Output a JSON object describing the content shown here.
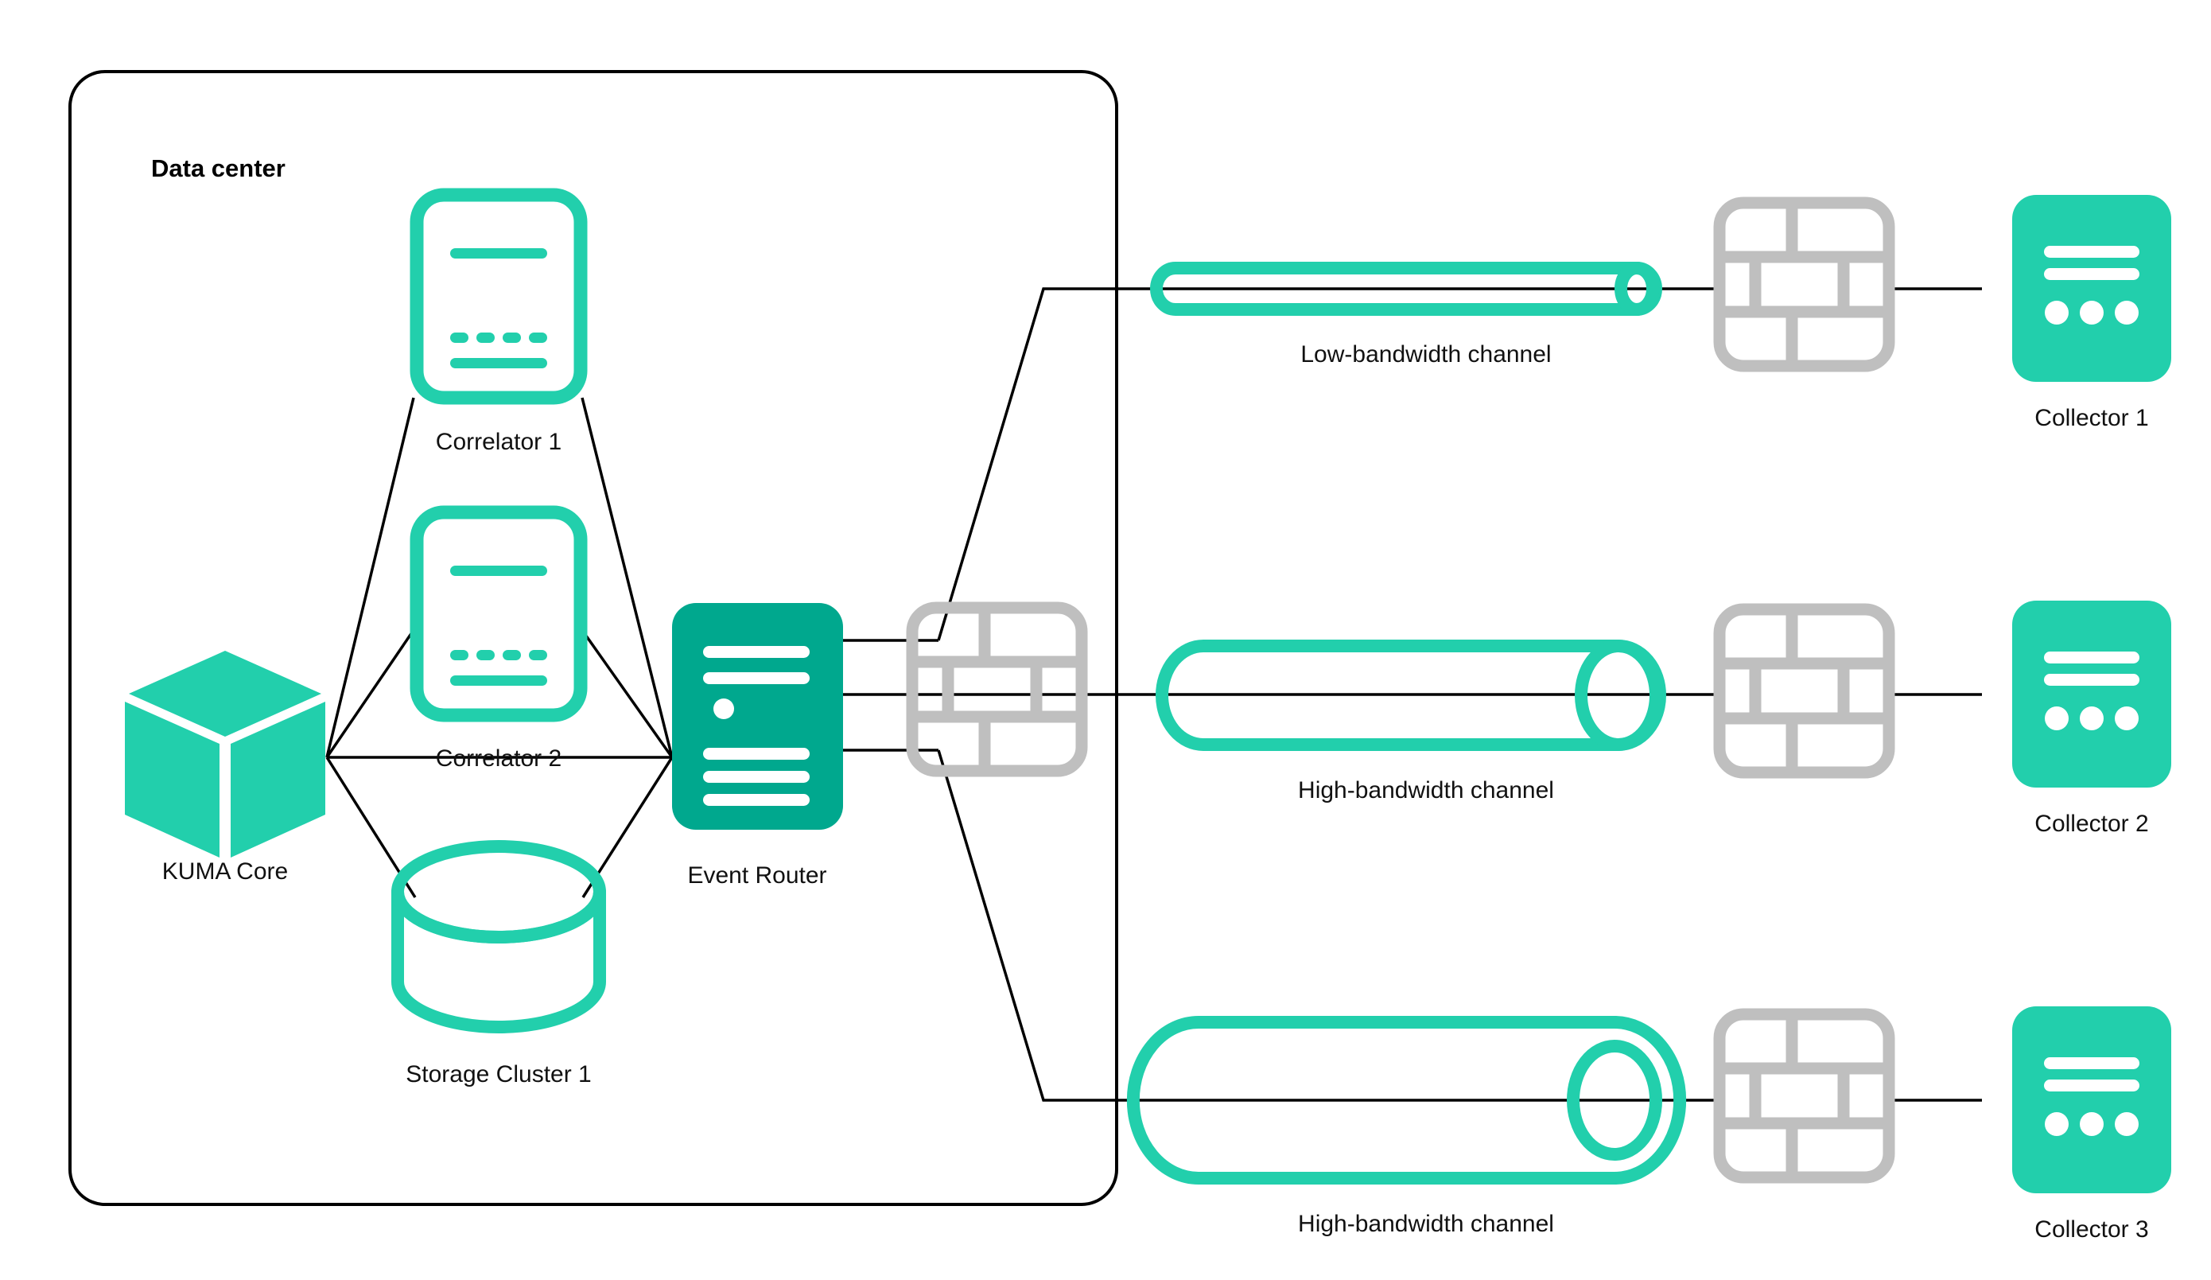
{
  "diagram": {
    "title": "KUMA distributed event routing topology",
    "colors": {
      "accent_light": "#22CFAC",
      "accent_dark": "#00A88E",
      "line": "#000000",
      "firewall_gray": "#BFBFBF",
      "background": "#FFFFFF",
      "text": "#111111"
    },
    "zone": {
      "label": "Data center"
    },
    "nodes": {
      "kuma_core": {
        "label": "KUMA Core",
        "icon": "cube-icon"
      },
      "correlator_1": {
        "label": "Correlator 1",
        "icon": "correlator-icon"
      },
      "correlator_2": {
        "label": "Correlator 2",
        "icon": "correlator-icon"
      },
      "storage_cluster_1": {
        "label": "Storage Cluster 1",
        "icon": "database-cylinder-icon"
      },
      "event_router": {
        "label": "Event Router",
        "icon": "server-icon"
      },
      "collector_1": {
        "label": "Collector 1",
        "icon": "collector-icon"
      },
      "collector_2": {
        "label": "Collector 2",
        "icon": "collector-icon"
      },
      "collector_3": {
        "label": "Collector 3",
        "icon": "collector-icon"
      }
    },
    "firewalls": [
      {
        "name": "firewall-inner",
        "icon": "firewall-brick-icon"
      },
      {
        "name": "firewall-remote-1",
        "icon": "firewall-brick-icon"
      },
      {
        "name": "firewall-remote-2",
        "icon": "firewall-brick-icon"
      },
      {
        "name": "firewall-remote-3",
        "icon": "firewall-brick-icon"
      }
    ],
    "channels": [
      {
        "label": "Low-bandwidth channel",
        "type": "low",
        "icon": "thin-pipe-icon"
      },
      {
        "label": "High-bandwidth channel",
        "type": "high",
        "icon": "wide-pipe-icon"
      },
      {
        "label": "High-bandwidth channel",
        "type": "high",
        "icon": "wide-pipe-icon"
      }
    ]
  }
}
